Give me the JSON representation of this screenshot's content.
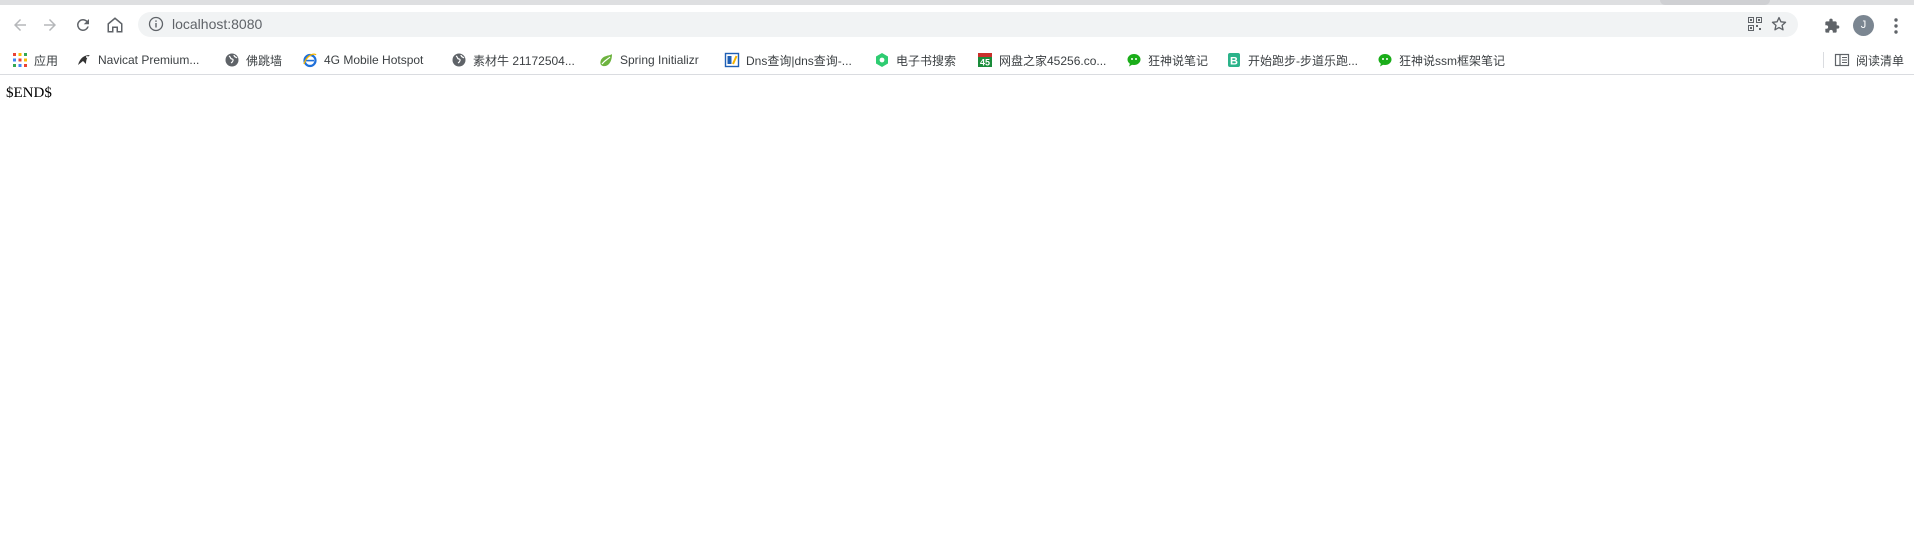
{
  "browser": {
    "url": "localhost:8080",
    "profile_initial": "J"
  },
  "bookmarks": [
    {
      "label": "应用",
      "icon": "apps-grid-icon"
    },
    {
      "label": "Navicat Premium...",
      "icon": "navicat-icon"
    },
    {
      "label": "佛跳墙",
      "icon": "globe-icon"
    },
    {
      "label": "4G Mobile Hotspot",
      "icon": "ie-icon"
    },
    {
      "label": "素材牛 21172504...",
      "icon": "globe-icon"
    },
    {
      "label": "Spring Initializr",
      "icon": "spring-icon"
    },
    {
      "label": "Dns查询|dns查询-...",
      "icon": "dns-icon"
    },
    {
      "label": "电子书搜索",
      "icon": "hex-icon"
    },
    {
      "label": "网盘之家45256.co...",
      "icon": "badge-45-icon"
    },
    {
      "label": "狂神说笔记",
      "icon": "wechat-icon"
    },
    {
      "label": "开始跑步-步道乐跑...",
      "icon": "b-icon"
    },
    {
      "label": "狂神说ssm框架笔记",
      "icon": "wechat-icon"
    }
  ],
  "reading_list": {
    "label": "阅读清单",
    "icon": "reading-list-icon"
  },
  "page": {
    "text": "$END$"
  },
  "colors": {
    "accent_green": "#1aad19",
    "spring_green": "#6db33f",
    "avatar_gray": "#7b8691"
  }
}
